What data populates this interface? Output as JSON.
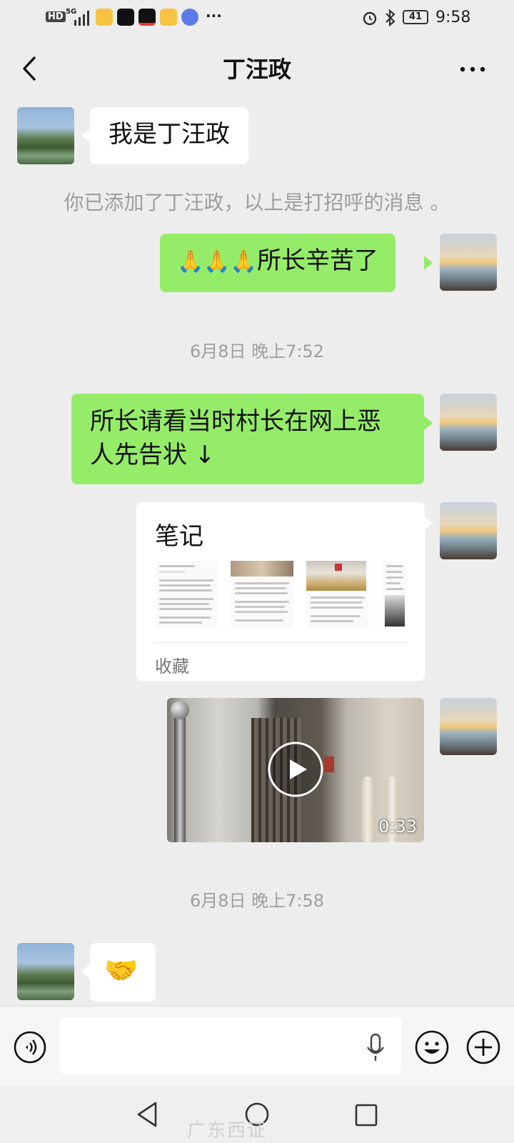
{
  "status_bar": {
    "left_labels": [
      "HD",
      "5G"
    ],
    "battery": "41",
    "time": "9:58",
    "icons": [
      "signal-icon",
      "weibo-icon",
      "tiktok-icon",
      "tiktok-lite-icon",
      "weibo-icon",
      "music-icon",
      "more-notifications-icon",
      "alarm-icon",
      "bluetooth-icon",
      "battery-icon"
    ]
  },
  "nav": {
    "title": "丁汪政",
    "back_icon": "chevron-left-icon",
    "more_icon": "more-dots-icon"
  },
  "messages": [
    {
      "side": "left",
      "type": "text",
      "text": "我是丁汪政"
    },
    {
      "type": "system",
      "text": "你已添加了丁汪政，以上是打招呼的消息 。"
    },
    {
      "side": "right",
      "type": "text",
      "emoji": "🙏🙏🙏",
      "text": "所长辛苦了"
    },
    {
      "type": "time",
      "text": "6月8日 晚上7:52"
    },
    {
      "side": "right",
      "type": "text",
      "text_line1": "所长请看当时村长在网上恶",
      "text_line2": "人先告状 ↓"
    },
    {
      "side": "right",
      "type": "note",
      "title": "笔记",
      "footer": "收藏"
    },
    {
      "side": "right",
      "type": "video",
      "duration": "0:33"
    },
    {
      "type": "time",
      "text": "6月8日 晚上7:58"
    },
    {
      "side": "left",
      "type": "emoji",
      "emoji": "🤝"
    }
  ],
  "input_bar": {
    "value": "",
    "voice_icon": "voice-mode-icon",
    "mic_icon": "microphone-icon",
    "emoji_icon": "emoji-face-icon",
    "plus_icon": "add-circle-icon"
  },
  "system_nav": {
    "back": "triangle-back-icon",
    "home": "circle-home-icon",
    "recents": "square-recents-icon"
  },
  "watermark": "广东西证"
}
